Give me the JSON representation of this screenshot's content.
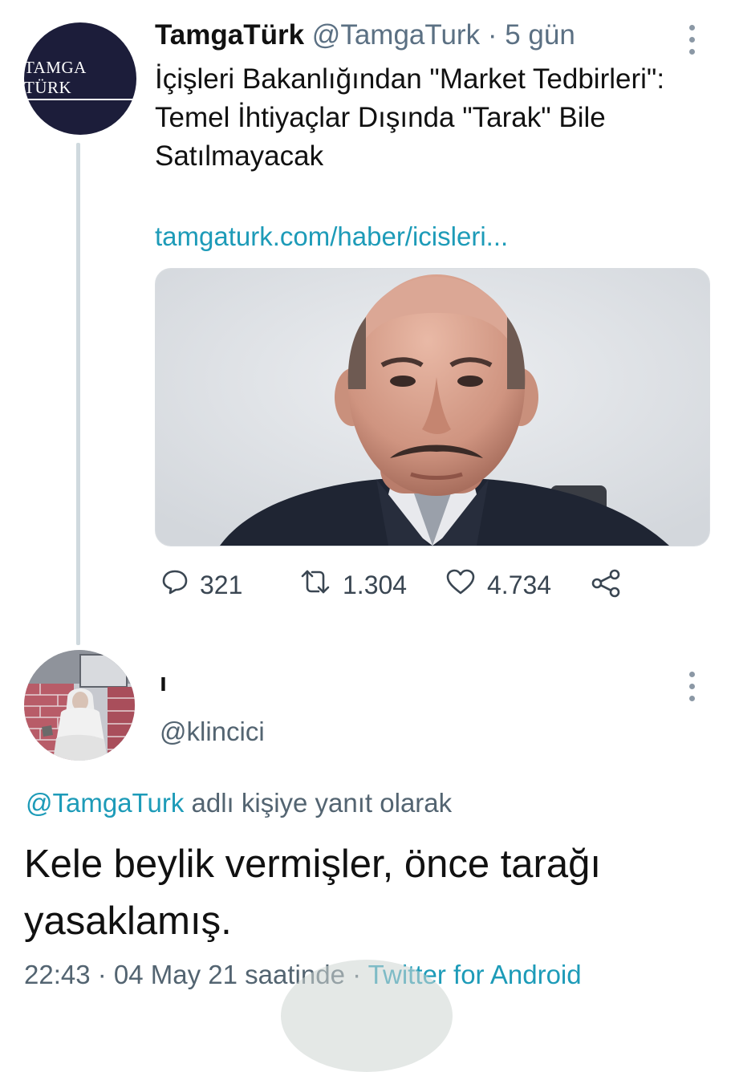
{
  "tweet1": {
    "avatar_text": "TAMGA TÜRK",
    "name": "TamgaTürk",
    "handle": "@TamgaTurk",
    "separator": "·",
    "time": "5 gün",
    "text": "İçişleri Bakanlığından \"Market Tedbirleri\": Temel İhtiyaçlar Dışında \"Tarak\" Bile Satılmayacak",
    "link": "tamgaturk.com/haber/icisleri...",
    "replies": "321",
    "retweets": "1.304",
    "likes": "4.734",
    "icons": [
      "reply-icon",
      "retweet-icon",
      "like-icon",
      "share-icon",
      "more-icon"
    ]
  },
  "tweet2": {
    "name": "ı",
    "handle": "@klincici",
    "reply_mention": "@TamgaTurk",
    "reply_suffix": "adlı kişiye yanıt olarak",
    "text": "Kele beylik vermişler, önce tarağı yasaklamış.",
    "timestamp": "22:43 · 04 May 21 saatinde ·",
    "source": "Twitter for Android"
  },
  "colors": {
    "link": "#1d9bb8",
    "secondary_text": "#536471",
    "thread_line": "#cfd9de",
    "avatar_bg": "#1c1d3a"
  }
}
